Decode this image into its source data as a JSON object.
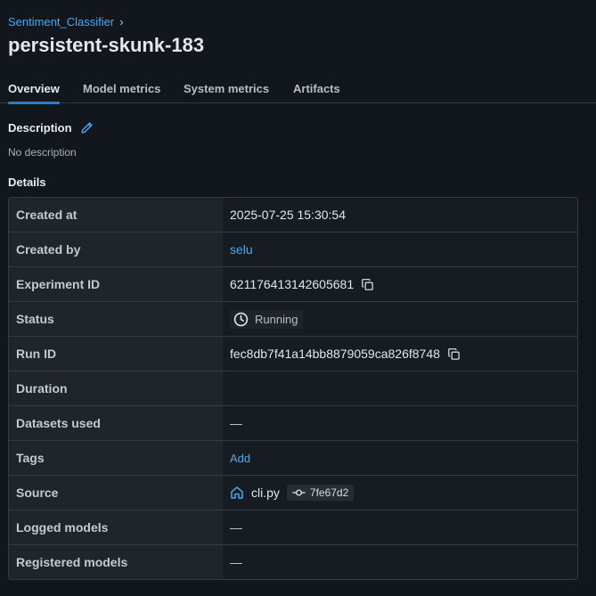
{
  "breadcrumb": {
    "experiment": "Sentiment_Classifier",
    "separator": "›"
  },
  "run": {
    "title": "persistent-skunk-183"
  },
  "tabs": [
    {
      "label": "Overview",
      "active": true
    },
    {
      "label": "Model metrics",
      "active": false
    },
    {
      "label": "System metrics",
      "active": false
    },
    {
      "label": "Artifacts",
      "active": false
    }
  ],
  "description": {
    "heading": "Description",
    "text": "No description",
    "edit_icon": "pencil-icon"
  },
  "details": {
    "heading": "Details",
    "rows": {
      "created_at": {
        "key": "Created at",
        "value": "2025-07-25 15:30:54"
      },
      "created_by": {
        "key": "Created by",
        "value": "selu"
      },
      "experiment_id": {
        "key": "Experiment ID",
        "value": "621176413142605681",
        "icon": "copy-icon"
      },
      "status": {
        "key": "Status",
        "value": "Running",
        "icon": "clock-icon"
      },
      "run_id": {
        "key": "Run ID",
        "value": "fec8db7f41a14bb8879059ca826f8748",
        "icon": "copy-icon"
      },
      "duration": {
        "key": "Duration",
        "value": ""
      },
      "datasets_used": {
        "key": "Datasets used",
        "value": "—"
      },
      "tags": {
        "key": "Tags",
        "value": "Add"
      },
      "source": {
        "key": "Source",
        "file": "cli.py",
        "commit": "7fe67d2",
        "icon": "home-icon",
        "commit_icon": "git-commit-icon"
      },
      "logged_models": {
        "key": "Logged models",
        "value": "—"
      },
      "registered_models": {
        "key": "Registered models",
        "value": "—"
      }
    }
  },
  "colors": {
    "accent": "#4ba8ee",
    "tab_underline": "#2f7ac4",
    "background": "#11171c"
  }
}
